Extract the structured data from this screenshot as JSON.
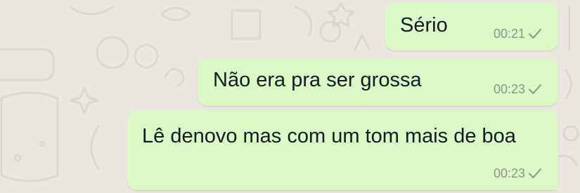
{
  "messages": [
    {
      "text": "Sério",
      "time": "00:21",
      "status": "sent"
    },
    {
      "text": "Não era pra ser grossa",
      "time": "00:23",
      "status": "sent"
    },
    {
      "text": "Lê denovo mas com um tom mais de boa",
      "time": "00:23",
      "status": "sent"
    }
  ],
  "colors": {
    "outgoing_bubble": "#dcf8c6",
    "wallpaper": "#ebe6df",
    "meta_text": "#8a968a"
  },
  "icons": {
    "status": "single-check-icon"
  }
}
